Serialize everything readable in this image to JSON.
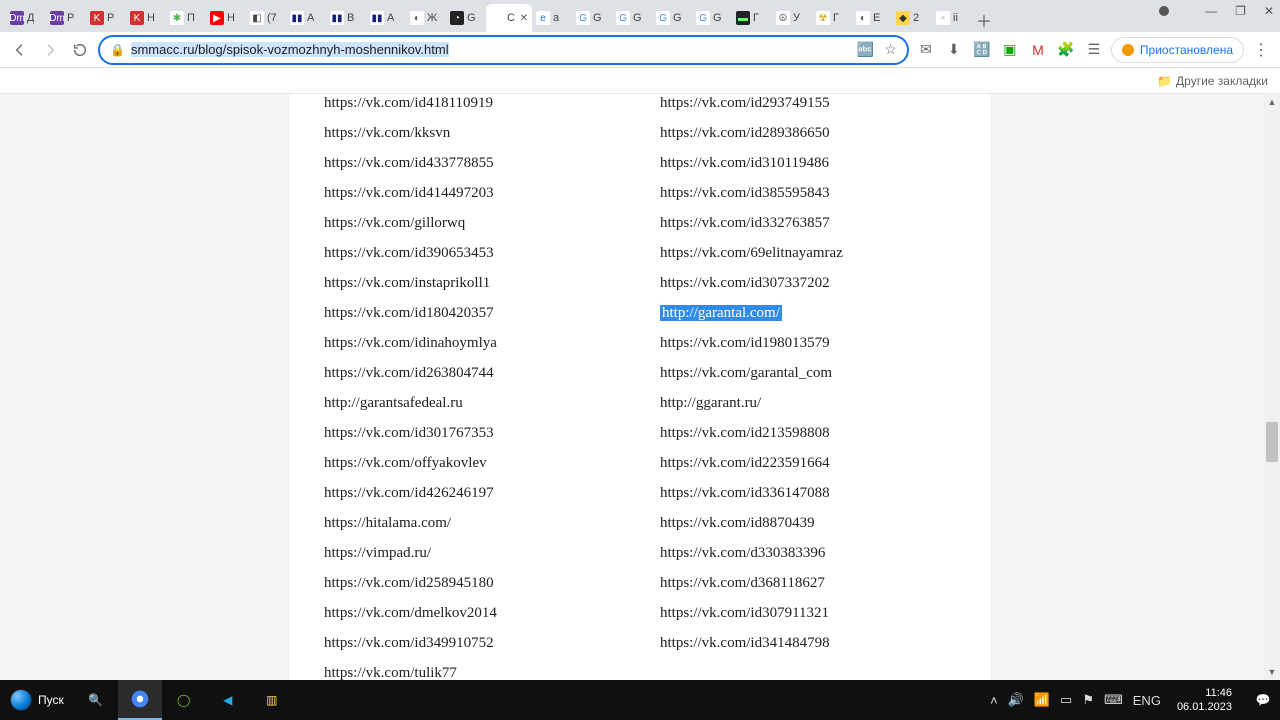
{
  "tabs": [
    {
      "label": "Д",
      "fav": "Dm",
      "favbg": "#6b3fa0",
      "favfg": "#fff"
    },
    {
      "label": "Р",
      "fav": "Dm",
      "favbg": "#6b3fa0",
      "favfg": "#fff"
    },
    {
      "label": "Р",
      "fav": "K",
      "favbg": "#d32f2f",
      "favfg": "#fff"
    },
    {
      "label": "Н",
      "fav": "K",
      "favbg": "#d32f2f",
      "favfg": "#fff"
    },
    {
      "label": "П",
      "fav": "✱",
      "favbg": "#fff",
      "favfg": "#4caf50"
    },
    {
      "label": "Н",
      "fav": "▶",
      "favbg": "#ff0000",
      "favfg": "#fff"
    },
    {
      "label": "(7",
      "fav": "◧",
      "favbg": "#fff",
      "favfg": "#444"
    },
    {
      "label": "А",
      "fav": "▮▮",
      "favbg": "#fff",
      "favfg": "#1a237e"
    },
    {
      "label": "В",
      "fav": "▮▮",
      "favbg": "#fff",
      "favfg": "#1a237e"
    },
    {
      "label": "А",
      "fav": "▮▮",
      "favbg": "#fff",
      "favfg": "#1a237e"
    },
    {
      "label": "Ж",
      "fav": "◐",
      "favbg": "#fff",
      "favfg": "#555"
    },
    {
      "label": "G",
      "fav": "◔",
      "favbg": "#222",
      "favfg": "#fff"
    },
    {
      "label": "Сп",
      "fav": "",
      "favbg": "#fff",
      "favfg": "#555",
      "active": true,
      "close": true
    },
    {
      "label": "a",
      "fav": "e",
      "favbg": "#fff",
      "favfg": "#1a73e8"
    },
    {
      "label": "G",
      "fav": "G",
      "favbg": "#fff",
      "favfg": "#4285f4"
    },
    {
      "label": "G",
      "fav": "G",
      "favbg": "#fff",
      "favfg": "#4285f4"
    },
    {
      "label": "G",
      "fav": "G",
      "favbg": "#fff",
      "favfg": "#4285f4"
    },
    {
      "label": "G",
      "fav": "G",
      "favbg": "#fff",
      "favfg": "#4285f4"
    },
    {
      "label": "Г",
      "fav": "▬",
      "favbg": "#222",
      "favfg": "#6f6"
    },
    {
      "label": "У",
      "fav": "☮",
      "favbg": "#fff",
      "favfg": "#555"
    },
    {
      "label": "Г",
      "fav": "☢",
      "favbg": "#fff",
      "favfg": "#c9a500"
    },
    {
      "label": "E",
      "fav": "◐",
      "favbg": "#fff",
      "favfg": "#555"
    },
    {
      "label": "2",
      "fav": "◆",
      "favbg": "#ffd54f",
      "favfg": "#333"
    },
    {
      "label": "ii",
      "fav": "▫",
      "favbg": "#fff",
      "favfg": "#888"
    }
  ],
  "window_controls": {
    "minimize": "—",
    "maximize": "❐",
    "close": "✕"
  },
  "toolbar": {
    "url_plain": "smmacc.ru/blog/spisok-vozmozhnyh-moshennikov.html",
    "paused_label": "Приостановлена"
  },
  "bookmarks": {
    "other": "Другие закладки"
  },
  "content": {
    "left": [
      "https://vk.com/id418110919",
      "https://vk.com/kksvn",
      "https://vk.com/id433778855",
      "https://vk.com/id414497203",
      "https://vk.com/gillorwq",
      "https://vk.com/id390653453",
      "https://vk.com/instaprikoll1",
      "https://vk.com/id180420357",
      "https://vk.com/idinahoymlya",
      "https://vk.com/id263804744",
      "http://garantsafedeal.ru",
      "https://vk.com/id301767353",
      "https://vk.com/offyakovlev",
      "https://vk.com/id426246197",
      "https://hitalama.com/",
      "https://vimpad.ru/",
      "https://vk.com/id258945180",
      "https://vk.com/dmelkov2014",
      "https://vk.com/id349910752",
      "https://vk.com/tulik77"
    ],
    "right": [
      {
        "t": "https://vk.com/id293749155"
      },
      {
        "t": "https://vk.com/id289386650"
      },
      {
        "t": "https://vk.com/id310119486"
      },
      {
        "t": "https://vk.com/id385595843"
      },
      {
        "t": "https://vk.com/id332763857"
      },
      {
        "t": "https://vk.com/69elitnayamraz"
      },
      {
        "t": "https://vk.com/id307337202"
      },
      {
        "t": "http://garantal.com/",
        "hl": true
      },
      {
        "t": "https://vk.com/id198013579"
      },
      {
        "t": "https://vk.com/garantal_com"
      },
      {
        "t": "http://ggarant.ru/"
      },
      {
        "t": "https://vk.com/id213598808"
      },
      {
        "t": "https://vk.com/id223591664"
      },
      {
        "t": "https://vk.com/id336147088"
      },
      {
        "t": "https://vk.com/id8870439"
      },
      {
        "t": "https://vk.com/d330383396"
      },
      {
        "t": "https://vk.com/d368118627"
      },
      {
        "t": "https://vk.com/id307911321"
      },
      {
        "t": "https://vk.com/id341484798"
      }
    ]
  },
  "taskbar": {
    "start": "Пуск",
    "lang": "ENG",
    "time": "11:46",
    "date": "06.01.2023"
  }
}
